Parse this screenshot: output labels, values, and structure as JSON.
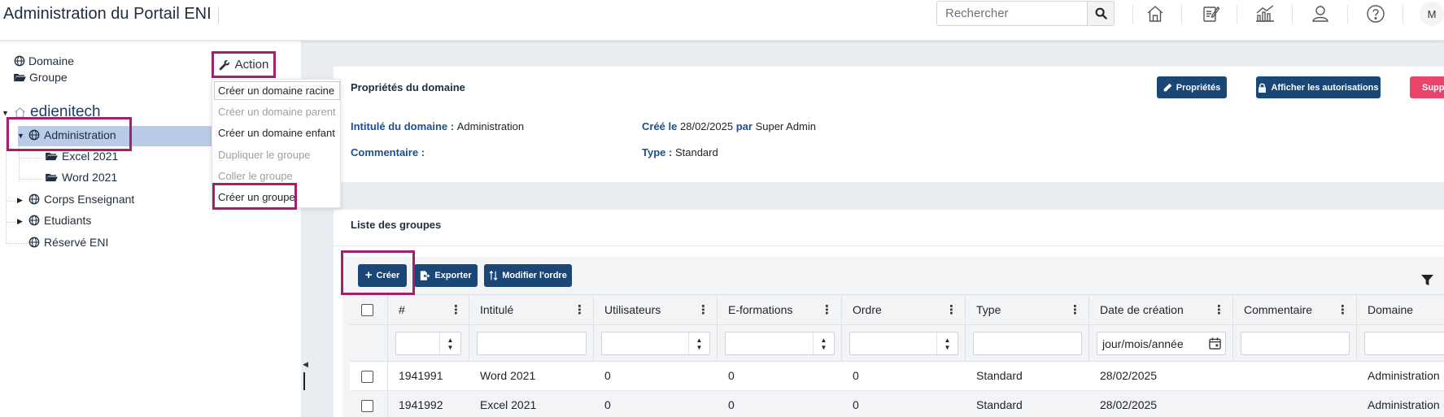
{
  "header": {
    "title": "Administration du Portail ENI",
    "search_placeholder": "Rechercher",
    "avatar_initial": "M"
  },
  "tree": {
    "legend": [
      {
        "icon": "globe-icon",
        "label": "Domaine"
      },
      {
        "icon": "folder-icon",
        "label": "Groupe"
      }
    ],
    "action_label": "Action",
    "root": "edienitech",
    "nodes": [
      {
        "label": "Administration",
        "type": "domain",
        "expanded": true,
        "selected": true
      },
      {
        "label": "Excel 2021",
        "type": "group"
      },
      {
        "label": "Word 2021",
        "type": "group"
      },
      {
        "label": "Corps Enseignant",
        "type": "domain"
      },
      {
        "label": "Etudiants",
        "type": "domain"
      },
      {
        "label": "Réservé ENI",
        "type": "domain"
      }
    ]
  },
  "action_menu": [
    {
      "label": "Créer un domaine racine",
      "enabled": true
    },
    {
      "label": "Créer un domaine parent",
      "enabled": false
    },
    {
      "label": "Créer un domaine enfant",
      "enabled": true
    },
    {
      "label": "Dupliquer le groupe",
      "enabled": false
    },
    {
      "label": "Coller le groupe",
      "enabled": false
    },
    {
      "label": "Créer un groupe",
      "enabled": true
    }
  ],
  "properties": {
    "title": "Propriétés du domaine",
    "btn_properties": "Propriétés",
    "btn_permissions": "Afficher les autorisations",
    "btn_delete": "Supprimer",
    "label_name": "Intitulé du domaine :",
    "value_name": "Administration",
    "label_created": "Créé le",
    "value_created_date": "28/02/2025",
    "label_by": "par",
    "value_created_by": "Super Admin",
    "label_comment": "Commentaire :",
    "label_type": "Type :",
    "value_type": "Standard"
  },
  "groups": {
    "title": "Liste des groupes",
    "btn_create": "Créer",
    "btn_export": "Exporter",
    "btn_order": "Modifier l'ordre",
    "columns": [
      "#",
      "Intitulé",
      "Utilisateurs",
      "E-formations",
      "Ordre",
      "Type",
      "Date de création",
      "Commentaire",
      "Domaine"
    ],
    "date_placeholder": "jour/mois/année",
    "rows": [
      {
        "id": "1941991",
        "name": "Word 2021",
        "users": "0",
        "eformations": "0",
        "order": "0",
        "type": "Standard",
        "date": "28/02/2025",
        "comment": "",
        "domain": "Administration"
      },
      {
        "id": "1941992",
        "name": "Excel 2021",
        "users": "0",
        "eformations": "0",
        "order": "0",
        "type": "Standard",
        "date": "28/02/2025",
        "comment": "",
        "domain": "Administration"
      }
    ]
  },
  "colors": {
    "primary": "#1a4776",
    "highlight": "#a3206a",
    "danger": "#e8456a",
    "selected": "#b8cbe8"
  }
}
